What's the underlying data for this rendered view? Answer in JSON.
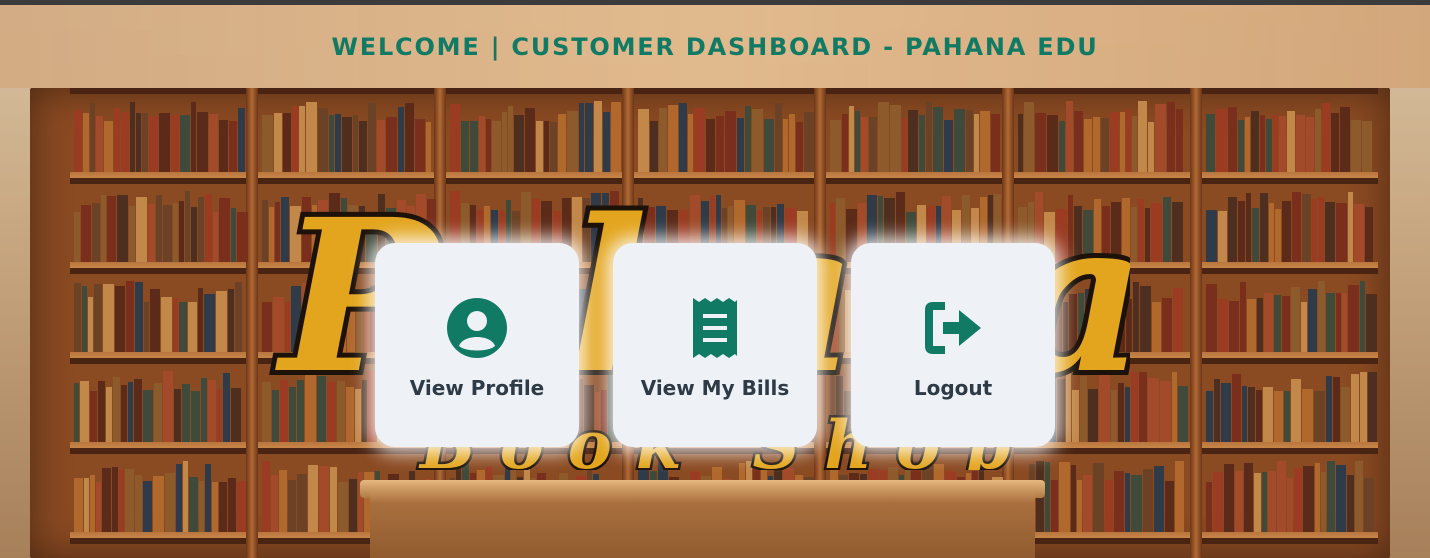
{
  "header": {
    "title": "WELCOME | CUSTOMER DASHBOARD - PAHANA EDU"
  },
  "background": {
    "logo_text": "Pahana",
    "logo_subtext": "Book Shop"
  },
  "cards": [
    {
      "label": "View Profile",
      "icon": "user-circle-icon"
    },
    {
      "label": "View My Bills",
      "icon": "receipt-icon"
    },
    {
      "label": "Logout",
      "icon": "logout-icon"
    }
  ],
  "colors": {
    "accent": "#117a65",
    "card_bg": "#eef2f7",
    "label": "#2e3a45"
  }
}
